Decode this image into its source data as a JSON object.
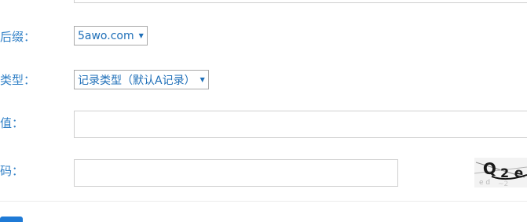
{
  "form": {
    "suffix": {
      "label": "后缀：",
      "selected": "5awo.com"
    },
    "type": {
      "label": "类型：",
      "selected": "记录类型（默认A记录）"
    },
    "value": {
      "label": "值：",
      "value": ""
    },
    "captcha": {
      "label": "码：",
      "value": "",
      "image_text": "Q2e"
    }
  },
  "colors": {
    "label": "#2f7fc6",
    "select_text": "#1f6fb8",
    "border": "#cfcfcf",
    "button": "#1f7ad6"
  },
  "icons": {
    "dropdown": "caret-down-icon"
  }
}
